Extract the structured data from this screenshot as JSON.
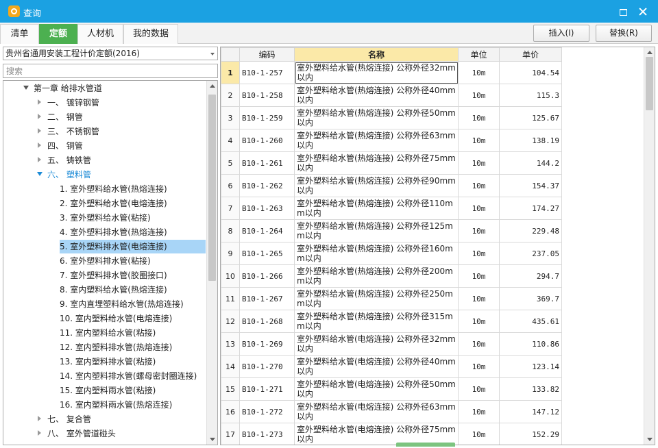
{
  "window": {
    "title": "查询"
  },
  "tabs": [
    {
      "label": "清单"
    },
    {
      "label": "定额"
    },
    {
      "label": "人材机"
    },
    {
      "label": "我的数据"
    }
  ],
  "toolbar": {
    "insert_label": "插入(I)",
    "replace_label": "替换(R)"
  },
  "left": {
    "quota_library": "贵州省通用安装工程计价定额(2016)",
    "search_placeholder": "搜索",
    "tree": [
      {
        "label": "第一章 给排水管道"
      },
      {
        "label": "一、 镀锌钢管"
      },
      {
        "label": "二、 钢管"
      },
      {
        "label": "三、 不锈钢管"
      },
      {
        "label": "四、 铜管"
      },
      {
        "label": "五、 铸铁管"
      },
      {
        "label": "六、 塑料管"
      },
      {
        "label": "1. 室外塑料给水管(热熔连接)"
      },
      {
        "label": "2. 室外塑料给水管(电熔连接)"
      },
      {
        "label": "3. 室外塑料给水管(粘接)"
      },
      {
        "label": "4. 室外塑料排水管(热熔连接)"
      },
      {
        "label": "5. 室外塑料排水管(电熔连接)"
      },
      {
        "label": "6. 室外塑料排水管(粘接)"
      },
      {
        "label": "7. 室外塑料排水管(胶圈接口)"
      },
      {
        "label": "8. 室内塑料给水管(热熔连接)"
      },
      {
        "label": "9. 室内直埋塑料给水管(热熔连接)"
      },
      {
        "label": "10. 室内塑料给水管(电熔连接)"
      },
      {
        "label": "11. 室内塑料给水管(粘接)"
      },
      {
        "label": "12. 室内塑料排水管(热熔连接)"
      },
      {
        "label": "13. 室内塑料排水管(粘接)"
      },
      {
        "label": "14. 室内塑料排水管(螺母密封圈连接)"
      },
      {
        "label": "15. 室内塑料雨水管(粘接)"
      },
      {
        "label": "16. 室内塑料雨水管(热熔连接)"
      },
      {
        "label": "七、 复合管"
      },
      {
        "label": "八、 室外管道碰头"
      }
    ]
  },
  "table": {
    "headers": {
      "code": "编码",
      "name": "名称",
      "unit": "单位",
      "price": "单价"
    },
    "rows": [
      {
        "idx": "1",
        "code": "B10-1-257",
        "name": "室外塑料给水管(热熔连接) 公称外径32mm以内",
        "unit": "10m",
        "price": "104.54"
      },
      {
        "idx": "2",
        "code": "B10-1-258",
        "name": "室外塑料给水管(热熔连接) 公称外径40mm以内",
        "unit": "10m",
        "price": "115.3"
      },
      {
        "idx": "3",
        "code": "B10-1-259",
        "name": "室外塑料给水管(热熔连接) 公称外径50mm以内",
        "unit": "10m",
        "price": "125.67"
      },
      {
        "idx": "4",
        "code": "B10-1-260",
        "name": "室外塑料给水管(热熔连接) 公称外径63mm以内",
        "unit": "10m",
        "price": "138.19"
      },
      {
        "idx": "5",
        "code": "B10-1-261",
        "name": "室外塑料给水管(热熔连接) 公称外径75mm以内",
        "unit": "10m",
        "price": "144.2"
      },
      {
        "idx": "6",
        "code": "B10-1-262",
        "name": "室外塑料给水管(热熔连接) 公称外径90mm以内",
        "unit": "10m",
        "price": "154.37"
      },
      {
        "idx": "7",
        "code": "B10-1-263",
        "name": "室外塑料给水管(热熔连接) 公称外径110mm以内",
        "unit": "10m",
        "price": "174.27"
      },
      {
        "idx": "8",
        "code": "B10-1-264",
        "name": "室外塑料给水管(热熔连接) 公称外径125mm以内",
        "unit": "10m",
        "price": "229.48"
      },
      {
        "idx": "9",
        "code": "B10-1-265",
        "name": "室外塑料给水管(热熔连接) 公称外径160mm以内",
        "unit": "10m",
        "price": "237.05"
      },
      {
        "idx": "10",
        "code": "B10-1-266",
        "name": "室外塑料给水管(热熔连接) 公称外径200mm以内",
        "unit": "10m",
        "price": "294.7"
      },
      {
        "idx": "11",
        "code": "B10-1-267",
        "name": "室外塑料给水管(热熔连接) 公称外径250mm以内",
        "unit": "10m",
        "price": "369.7"
      },
      {
        "idx": "12",
        "code": "B10-1-268",
        "name": "室外塑料给水管(热熔连接) 公称外径315mm以内",
        "unit": "10m",
        "price": "435.61"
      },
      {
        "idx": "13",
        "code": "B10-1-269",
        "name": "室外塑料给水管(电熔连接) 公称外径32mm以内",
        "unit": "10m",
        "price": "110.86"
      },
      {
        "idx": "14",
        "code": "B10-1-270",
        "name": "室外塑料给水管(电熔连接) 公称外径40mm以内",
        "unit": "10m",
        "price": "123.14"
      },
      {
        "idx": "15",
        "code": "B10-1-271",
        "name": "室外塑料给水管(电熔连接) 公称外径50mm以内",
        "unit": "10m",
        "price": "133.82"
      },
      {
        "idx": "16",
        "code": "B10-1-272",
        "name": "室外塑料给水管(电熔连接) 公称外径63mm以内",
        "unit": "10m",
        "price": "147.12"
      },
      {
        "idx": "17",
        "code": "B10-1-273",
        "name": "室外塑料给水管(电熔连接) 公称外径75mm以内",
        "unit": "10m",
        "price": "152.29"
      }
    ]
  }
}
